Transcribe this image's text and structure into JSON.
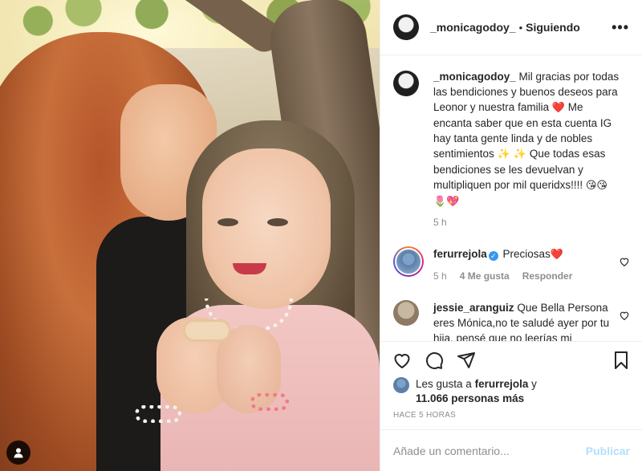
{
  "post": {
    "username": "_monicagodoy_",
    "follow_status": "Siguiendo",
    "more_icon": "more-horizontal-icon"
  },
  "caption": {
    "username": "_monicagodoy_",
    "text_1": "Mil gracias por todas las bendiciones y buenos deseos para Leonor y nuestra familia",
    "heart_emoji": "❤️",
    "text_2": "Me encanta saber que en esta cuenta IG hay tanta gente linda y de nobles sentimientos",
    "sparkle_emojis": "✨ ✨",
    "text_3": "Que todas esas bendiciones se les devuelvan y multipliquen por mil queridxs!!!!",
    "end_emojis": "😘😘",
    "end_emojis_2": "🌷💖",
    "time": "5 h"
  },
  "comments": [
    {
      "username": "ferurrejola",
      "verified": true,
      "text": "Preciosas",
      "emoji": "❤️",
      "time": "5 h",
      "likes": "4 Me gusta",
      "reply": "Responder"
    },
    {
      "username": "jessie_aranguiz",
      "text": "Que Bella Persona eres Mónica,no te saludé ayer por tu hija, pensé que no leerías mi"
    }
  ],
  "likes": {
    "prefix": "Les gusta a",
    "user": "ferurrejola",
    "joiner": "y",
    "count": "11.066 personas más"
  },
  "posted_ago": "HACE 5 HORAS",
  "add_comment": {
    "placeholder": "Añade un comentario...",
    "post_label": "Publicar"
  }
}
